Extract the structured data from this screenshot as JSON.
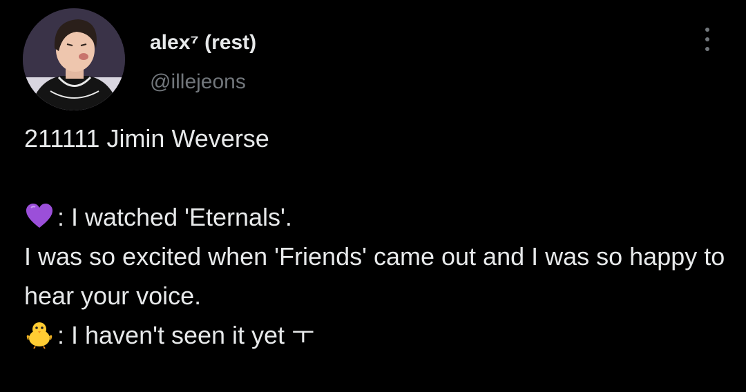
{
  "user": {
    "display_name": "alex⁷ (rest)",
    "handle": "@illejeons"
  },
  "more_icon": "more-horizontal-icon",
  "tweet": {
    "header_line": "211111 Jimin Weverse",
    "lines": [
      {
        "emoji": "purple-heart-icon",
        "text": ": I watched 'Eternals'."
      },
      {
        "text": "I was so excited when 'Friends' came out and I was so happy to hear your voice."
      },
      {
        "emoji": "baby-chick-icon",
        "text": ": I haven't seen it yet ㅜ"
      }
    ]
  },
  "colors": {
    "background": "#000000",
    "text": "#e7e9ea",
    "secondary": "#71767b",
    "purple_heart": "#9b4fd9",
    "chick": "#ffcc33"
  }
}
